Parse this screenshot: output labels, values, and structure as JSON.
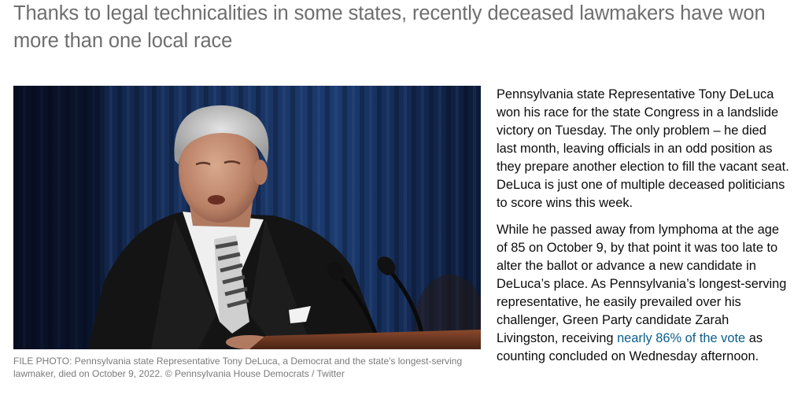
{
  "subheadline": "Thanks to legal technicalities in some states, recently deceased lawmakers have won more than one local race",
  "photo": {
    "alt": "Older man with gray hair in a dark suit and striped tie speaking at a podium with microphones, blue curtain background",
    "caption": "FILE PHOTO: Pennsylvania state Representative Tony DeLuca, a Democrat and the state's longest-serving lawmaker, died on October 9, 2022. ©  Pennsylvania House Democrats / Twitter"
  },
  "article": {
    "p1": "Pennsylvania state Representative Tony DeLuca won his race for the state Congress in a landslide victory on Tuesday. The only problem – he died last month, leaving officials in an odd position as they prepare another election to fill the vacant seat. DeLuca is just one of multiple deceased politicians to score wins this week.",
    "p2_before": "While he passed away from lymphoma at the age of 85 on October 9, by that point it was too late to alter the ballot or advance a new candidate in DeLuca’s place. As Pennsylvania’s longest-serving representative, he easily prevailed over his challenger, Green Party candidate Zarah Livingston, receiving ",
    "p2_link": "nearly 86% of the vote",
    "p2_after": " as counting concluded on Wednesday afternoon."
  },
  "colors": {
    "subheadline": "#6e6e6e",
    "body_text": "#0c0c0c",
    "caption": "#7a7a7a",
    "link": "#0c5d8a"
  }
}
